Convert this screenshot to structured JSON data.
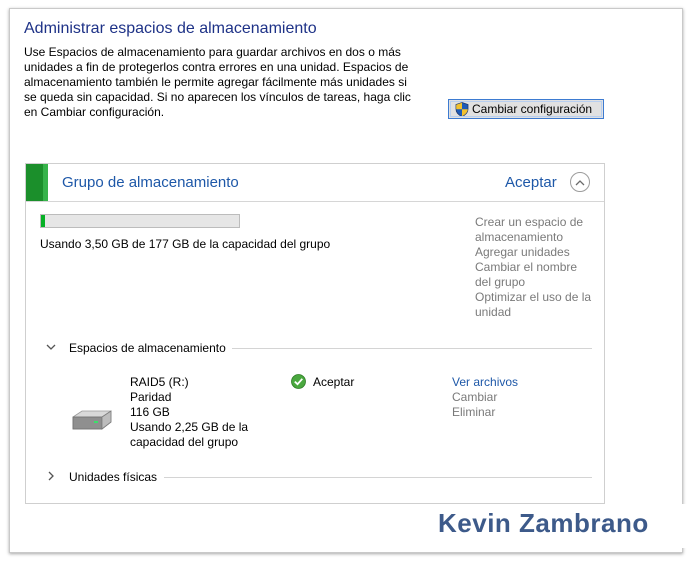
{
  "page": {
    "title": "Administrar espacios de almacenamiento",
    "description": "Use Espacios de almacenamiento para guardar archivos en dos o más unidades a fin de protegerlos contra errores en una unidad. Espacios de almacenamiento también le permite agregar fácilmente más unidades si se queda sin capacidad. Si no aparecen los vínculos de tareas, haga clic en Cambiar configuración.",
    "change_settings_label": "Cambiar configuración"
  },
  "pool": {
    "title": "Grupo de almacenamiento",
    "status": "Aceptar",
    "usage_fraction": 0.0198,
    "usage_text": "Usando 3,50 GB de 177 GB de la capacidad del grupo",
    "tasks": [
      "Crear un espacio de almacenamiento",
      "Agregar unidades",
      "Cambiar el nombre del grupo",
      "Optimizar el uso de la unidad"
    ]
  },
  "spaces_section": {
    "label": "Espacios de almacenamiento",
    "space": {
      "name": "RAID5 (R:)",
      "resiliency": "Paridad",
      "size": "116 GB",
      "usage": "Usando 2,25 GB de la capacidad del grupo",
      "status": "Aceptar",
      "actions": {
        "view_files": "Ver archivos",
        "change": "Cambiar",
        "delete": "Eliminar"
      }
    }
  },
  "physical_section": {
    "label": "Unidades físicas"
  },
  "watermark": "Kevin Zambrano",
  "colors": {
    "title_blue": "#1e3287",
    "link_blue": "#1e58a8",
    "accent_green": "#1b8f2b",
    "bar_green": "#06b025"
  },
  "icons": {
    "shield": "uac-shield-icon",
    "collapse": "chevron-up-icon",
    "expanded": "chevron-down-icon",
    "collapsed": "chevron-right-icon",
    "ok": "check-circle-icon",
    "drive": "hard-drive-icon"
  }
}
